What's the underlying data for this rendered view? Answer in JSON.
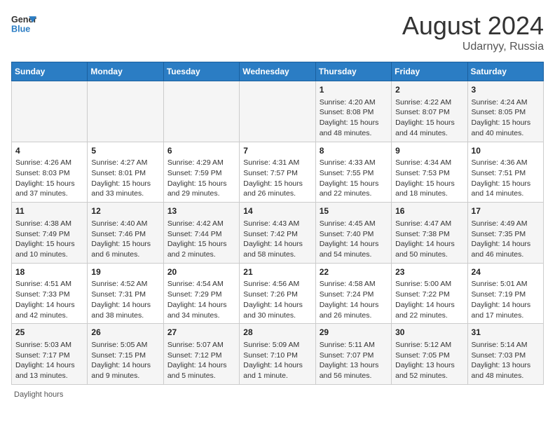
{
  "header": {
    "logo_line1": "General",
    "logo_line2": "Blue",
    "month_title": "August 2024",
    "subtitle": "Udarnyy, Russia"
  },
  "days_of_week": [
    "Sunday",
    "Monday",
    "Tuesday",
    "Wednesday",
    "Thursday",
    "Friday",
    "Saturday"
  ],
  "footer": {
    "daylight_label": "Daylight hours"
  },
  "weeks": [
    [
      {
        "day": "",
        "info": ""
      },
      {
        "day": "",
        "info": ""
      },
      {
        "day": "",
        "info": ""
      },
      {
        "day": "",
        "info": ""
      },
      {
        "day": "1",
        "info": "Sunrise: 4:20 AM\nSunset: 8:08 PM\nDaylight: 15 hours\nand 48 minutes."
      },
      {
        "day": "2",
        "info": "Sunrise: 4:22 AM\nSunset: 8:07 PM\nDaylight: 15 hours\nand 44 minutes."
      },
      {
        "day": "3",
        "info": "Sunrise: 4:24 AM\nSunset: 8:05 PM\nDaylight: 15 hours\nand 40 minutes."
      }
    ],
    [
      {
        "day": "4",
        "info": "Sunrise: 4:26 AM\nSunset: 8:03 PM\nDaylight: 15 hours\nand 37 minutes."
      },
      {
        "day": "5",
        "info": "Sunrise: 4:27 AM\nSunset: 8:01 PM\nDaylight: 15 hours\nand 33 minutes."
      },
      {
        "day": "6",
        "info": "Sunrise: 4:29 AM\nSunset: 7:59 PM\nDaylight: 15 hours\nand 29 minutes."
      },
      {
        "day": "7",
        "info": "Sunrise: 4:31 AM\nSunset: 7:57 PM\nDaylight: 15 hours\nand 26 minutes."
      },
      {
        "day": "8",
        "info": "Sunrise: 4:33 AM\nSunset: 7:55 PM\nDaylight: 15 hours\nand 22 minutes."
      },
      {
        "day": "9",
        "info": "Sunrise: 4:34 AM\nSunset: 7:53 PM\nDaylight: 15 hours\nand 18 minutes."
      },
      {
        "day": "10",
        "info": "Sunrise: 4:36 AM\nSunset: 7:51 PM\nDaylight: 15 hours\nand 14 minutes."
      }
    ],
    [
      {
        "day": "11",
        "info": "Sunrise: 4:38 AM\nSunset: 7:49 PM\nDaylight: 15 hours\nand 10 minutes."
      },
      {
        "day": "12",
        "info": "Sunrise: 4:40 AM\nSunset: 7:46 PM\nDaylight: 15 hours\nand 6 minutes."
      },
      {
        "day": "13",
        "info": "Sunrise: 4:42 AM\nSunset: 7:44 PM\nDaylight: 15 hours\nand 2 minutes."
      },
      {
        "day": "14",
        "info": "Sunrise: 4:43 AM\nSunset: 7:42 PM\nDaylight: 14 hours\nand 58 minutes."
      },
      {
        "day": "15",
        "info": "Sunrise: 4:45 AM\nSunset: 7:40 PM\nDaylight: 14 hours\nand 54 minutes."
      },
      {
        "day": "16",
        "info": "Sunrise: 4:47 AM\nSunset: 7:38 PM\nDaylight: 14 hours\nand 50 minutes."
      },
      {
        "day": "17",
        "info": "Sunrise: 4:49 AM\nSunset: 7:35 PM\nDaylight: 14 hours\nand 46 minutes."
      }
    ],
    [
      {
        "day": "18",
        "info": "Sunrise: 4:51 AM\nSunset: 7:33 PM\nDaylight: 14 hours\nand 42 minutes."
      },
      {
        "day": "19",
        "info": "Sunrise: 4:52 AM\nSunset: 7:31 PM\nDaylight: 14 hours\nand 38 minutes."
      },
      {
        "day": "20",
        "info": "Sunrise: 4:54 AM\nSunset: 7:29 PM\nDaylight: 14 hours\nand 34 minutes."
      },
      {
        "day": "21",
        "info": "Sunrise: 4:56 AM\nSunset: 7:26 PM\nDaylight: 14 hours\nand 30 minutes."
      },
      {
        "day": "22",
        "info": "Sunrise: 4:58 AM\nSunset: 7:24 PM\nDaylight: 14 hours\nand 26 minutes."
      },
      {
        "day": "23",
        "info": "Sunrise: 5:00 AM\nSunset: 7:22 PM\nDaylight: 14 hours\nand 22 minutes."
      },
      {
        "day": "24",
        "info": "Sunrise: 5:01 AM\nSunset: 7:19 PM\nDaylight: 14 hours\nand 17 minutes."
      }
    ],
    [
      {
        "day": "25",
        "info": "Sunrise: 5:03 AM\nSunset: 7:17 PM\nDaylight: 14 hours\nand 13 minutes."
      },
      {
        "day": "26",
        "info": "Sunrise: 5:05 AM\nSunset: 7:15 PM\nDaylight: 14 hours\nand 9 minutes."
      },
      {
        "day": "27",
        "info": "Sunrise: 5:07 AM\nSunset: 7:12 PM\nDaylight: 14 hours\nand 5 minutes."
      },
      {
        "day": "28",
        "info": "Sunrise: 5:09 AM\nSunset: 7:10 PM\nDaylight: 14 hours\nand 1 minute."
      },
      {
        "day": "29",
        "info": "Sunrise: 5:11 AM\nSunset: 7:07 PM\nDaylight: 13 hours\nand 56 minutes."
      },
      {
        "day": "30",
        "info": "Sunrise: 5:12 AM\nSunset: 7:05 PM\nDaylight: 13 hours\nand 52 minutes."
      },
      {
        "day": "31",
        "info": "Sunrise: 5:14 AM\nSunset: 7:03 PM\nDaylight: 13 hours\nand 48 minutes."
      }
    ]
  ]
}
